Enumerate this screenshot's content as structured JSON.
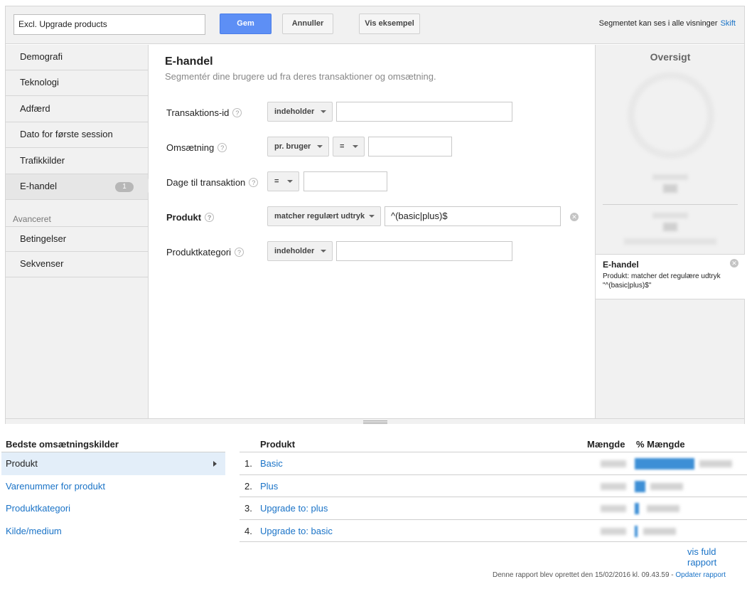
{
  "topbar": {
    "segment_name": "Excl. Upgrade products",
    "save_label": "Gem",
    "cancel_label": "Annuller",
    "preview_label": "Vis eksempel",
    "visibility_text": "Segmentet kan ses i alle visninger",
    "visibility_link": "Skift"
  },
  "nav": {
    "items": [
      {
        "label": "Demografi"
      },
      {
        "label": "Teknologi"
      },
      {
        "label": "Adfærd"
      },
      {
        "label": "Dato for første session"
      },
      {
        "label": "Trafikkilder"
      },
      {
        "label": "E-handel",
        "badge": "1",
        "active": true
      }
    ],
    "advanced_heading": "Avanceret",
    "advanced_items": [
      {
        "label": "Betingelser"
      },
      {
        "label": "Sekvenser"
      }
    ]
  },
  "main": {
    "title": "E-handel",
    "subtitle": "Segmentér dine brugere ud fra deres transaktioner og omsætning.",
    "help_glyph": "?",
    "rows": [
      {
        "label": "Transaktions-id",
        "operator": "indeholder",
        "value": ""
      },
      {
        "label": "Omsætning",
        "scope": "pr. bruger",
        "operator": "=",
        "value": ""
      },
      {
        "label": "Dage til transaktion",
        "operator": "=",
        "value": ""
      },
      {
        "label": "Produkt",
        "operator": "matcher regulært udtryk",
        "value": "^(basic|plus)$"
      },
      {
        "label": "Produktkategori",
        "operator": "indeholder",
        "value": ""
      }
    ]
  },
  "summary": {
    "title": "Oversigt",
    "card_title": "E-handel",
    "card_desc": "Produkt: matcher det regulære udtryk \"^(basic|plus)$\""
  },
  "sources": {
    "heading": "Bedste omsætningskilder",
    "items": [
      {
        "label": "Produkt",
        "active": true
      },
      {
        "label": "Varenummer for produkt"
      },
      {
        "label": "Produktkategori"
      },
      {
        "label": "Kilde/medium"
      }
    ]
  },
  "table": {
    "headers": {
      "product": "Produkt",
      "quantity": "Mængde",
      "pct_quantity": "% Mængde"
    },
    "rows": [
      {
        "rank": "1.",
        "product": "Basic",
        "bar": 0.78
      },
      {
        "rank": "2.",
        "product": "Plus",
        "bar": 0.14
      },
      {
        "rank": "3.",
        "product": "Upgrade to: plus",
        "bar": 0.06
      },
      {
        "rank": "4.",
        "product": "Upgrade to: basic",
        "bar": 0.03
      }
    ],
    "full_report_link": "vis fuld rapport"
  },
  "footer": {
    "text": "Denne rapport blev oprettet den 15/02/2016 kl. 09.43.59 - ",
    "link": "Opdater rapport"
  }
}
